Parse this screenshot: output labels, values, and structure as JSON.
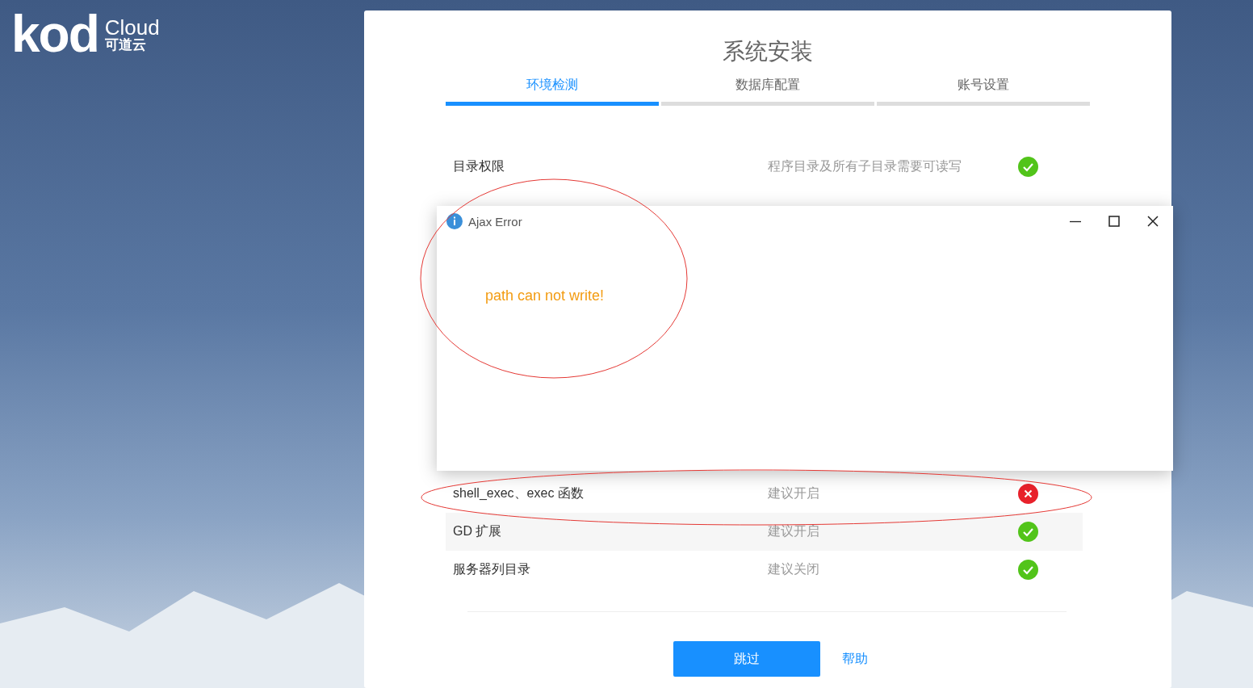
{
  "logo": {
    "brand": "kod",
    "product": "Cloud",
    "tagline": "可道云"
  },
  "title": "系统安装",
  "steps": [
    {
      "label": "环境检测",
      "selected": true
    },
    {
      "label": "数据库配置",
      "selected": false
    },
    {
      "label": "账号设置",
      "selected": false
    }
  ],
  "checks": [
    {
      "name": "目录权限",
      "requirement": "程序目录及所有子目录需要可读写",
      "passed": true
    },
    {
      "kind": "hidden"
    },
    {
      "name": "shell_exec、exec 函数",
      "requirement": "建议开启",
      "passed": false
    },
    {
      "name": "GD 扩展",
      "requirement": "建议开启",
      "passed": true
    },
    {
      "name": "服务器列目录",
      "requirement": "建议关闭",
      "passed": true
    }
  ],
  "buttons": {
    "skip": "跳过",
    "help": "帮助"
  },
  "dialog": {
    "title": "Ajax Error",
    "message": "path can not write!"
  }
}
